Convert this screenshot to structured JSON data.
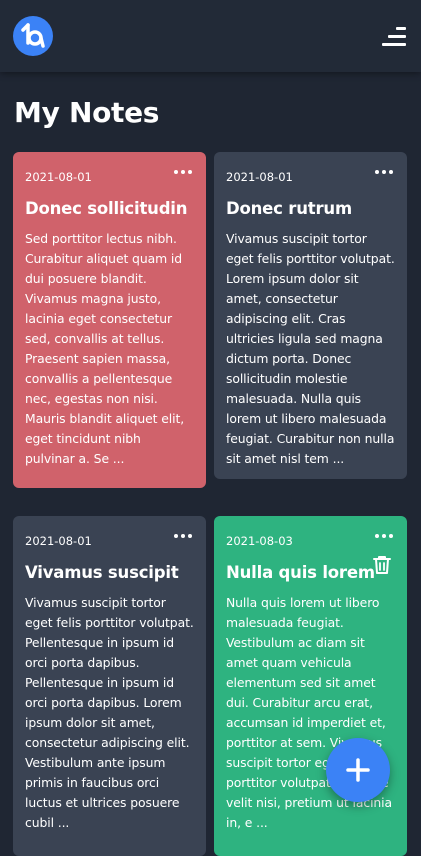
{
  "header": {
    "logo_icon": "app-logo-icon",
    "menu_icon": "menu-icon"
  },
  "page": {
    "title": "My Notes"
  },
  "colors": {
    "background": "#1f2633",
    "accent": "#3b82f6",
    "card_red": "#d0626b",
    "card_dark": "#3a4353",
    "card_green": "#2eb380"
  },
  "notes": [
    {
      "date": "2021-08-01",
      "title": "Donec sollicitudin",
      "body": "Sed porttitor lectus nibh. Curabitur aliquet quam id dui posuere blandit. Vivamus magna justo, lacinia eget consectetur sed, convallis at tellus. Praesent sapien massa, convallis a pellentesque nec, egestas non nisi. Mauris blandit aliquet elit, eget tincidunt nibh pulvinar a. Se ...",
      "color": "#d0626b"
    },
    {
      "date": "2021-08-01",
      "title": "Donec rutrum",
      "body": "Vivamus suscipit tortor eget felis porttitor volutpat. Lorem ipsum dolor sit amet, consectetur adipiscing elit. Cras ultricies ligula sed magna dictum porta. Donec sollicitudin molestie malesuada. Nulla quis lorem ut libero malesuada feugiat. Curabitur non nulla sit amet nisl tem ...",
      "color": "#3a4353"
    },
    {
      "date": "2021-08-01",
      "title": "Vivamus suscipit",
      "body": "Vivamus suscipit tortor eget felis porttitor volutpat. Pellentesque in ipsum id orci porta dapibus. Pellentesque in ipsum id orci porta dapibus. Lorem ipsum dolor sit amet, consectetur adipiscing elit. Vestibulum ante ipsum primis in faucibus orci luctus et ultrices posuere cubil ...",
      "color": "#3a4353"
    },
    {
      "date": "2021-08-03",
      "title": "Nulla quis lorem",
      "body": "Nulla quis lorem ut libero malesuada feugiat. Vestibulum ac diam sit amet quam vehicula elementum sed sit amet dui. Curabitur arcu erat, accumsan id imperdiet et, porttitor at sem. Vivamus suscipit tortor eget felis porttitor volutpat. Quisque velit nisi, pretium ut lacinia in, e ...",
      "color": "#2eb380",
      "action_icon": "trash-icon"
    }
  ],
  "fab": {
    "icon": "plus-icon"
  }
}
